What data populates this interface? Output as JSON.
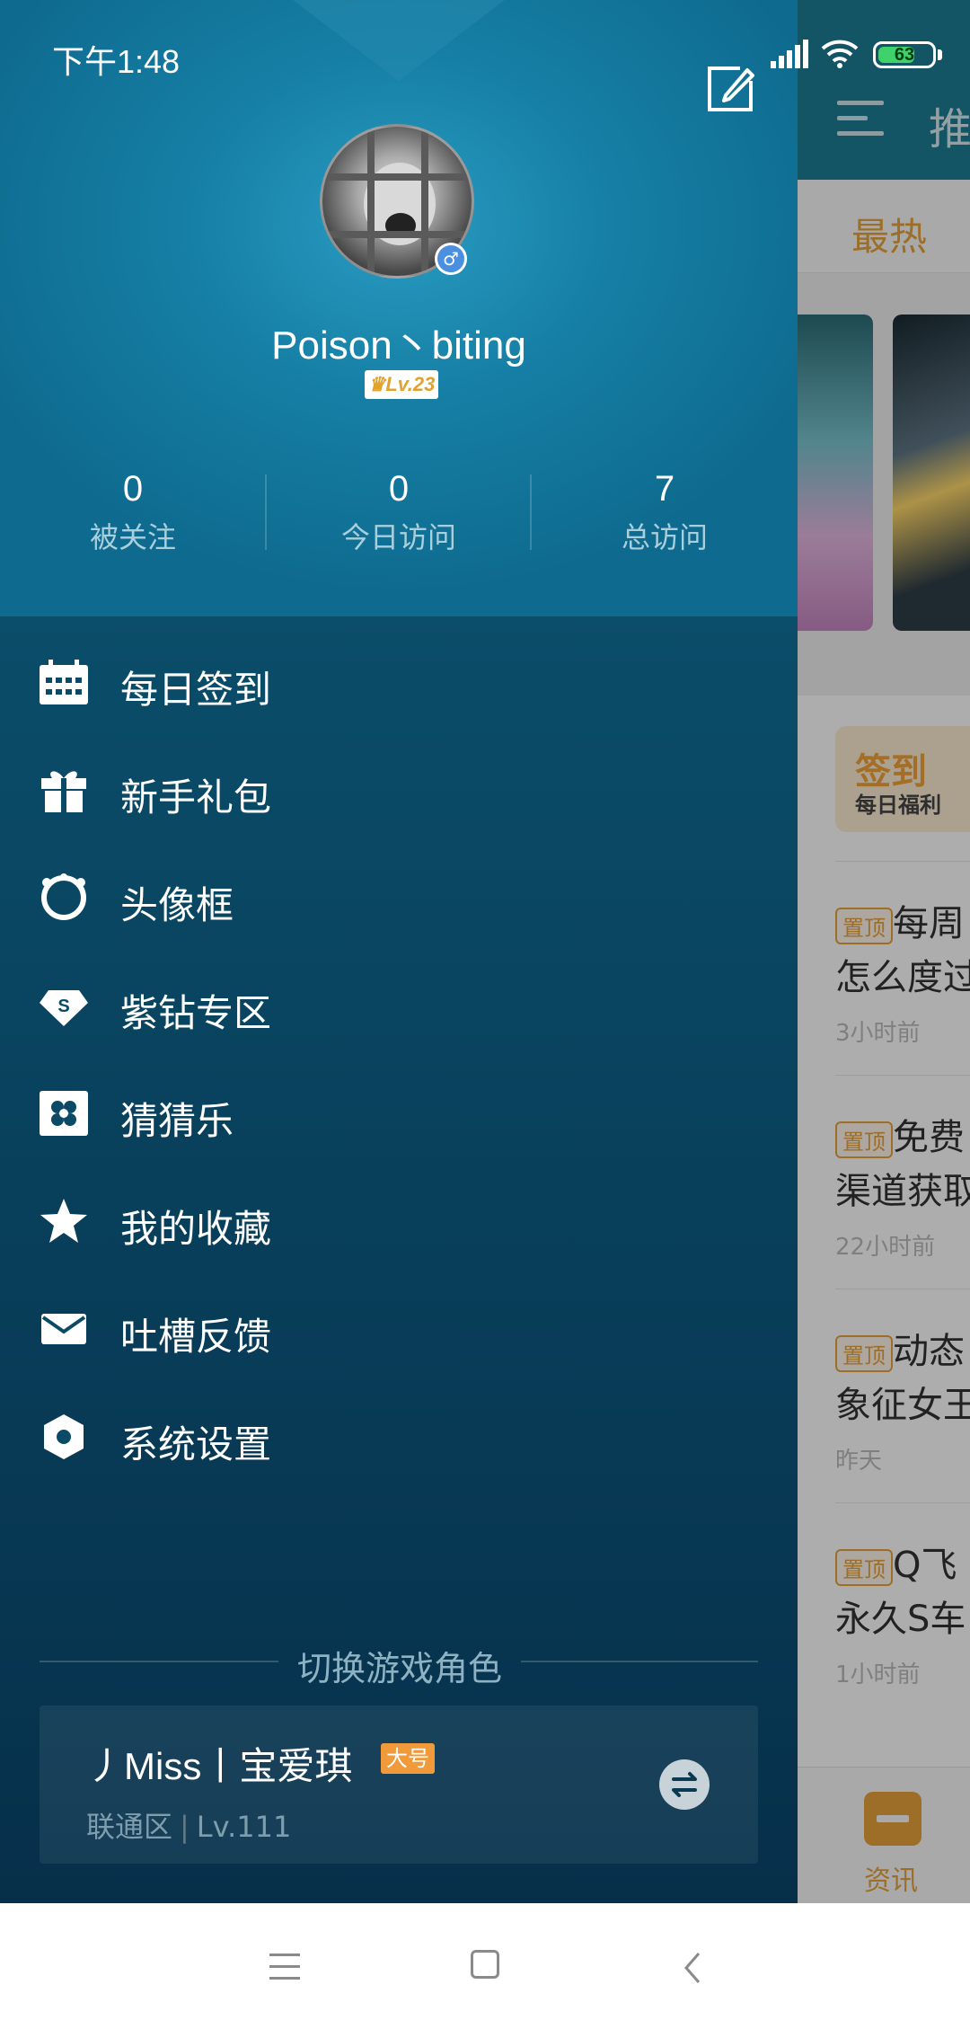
{
  "status_bar": {
    "time": "下午1:48",
    "battery": "63"
  },
  "background_page": {
    "title_partial": "推",
    "tab_hot": "最热",
    "checkin_title": "签到",
    "checkin_sub": "每日福利",
    "news": [
      {
        "tag": "置顶",
        "line1": "每周",
        "line2": "怎么度过",
        "time": "3小时前"
      },
      {
        "tag": "置顶",
        "line1": "免费",
        "line2": "渠道获取",
        "time": "22小时前"
      },
      {
        "tag": "置顶",
        "line1": "动态",
        "line2": "象征女王",
        "time": "昨天"
      },
      {
        "tag": "置顶",
        "line1": "Q飞",
        "line2": "永久S车",
        "time": "1小时前"
      }
    ],
    "bottom_nav_label": "资讯"
  },
  "profile": {
    "username": "Poison丶biting",
    "level": "Lv.23",
    "gender_symbol": "♂",
    "stats": [
      {
        "value": "0",
        "label": "被关注"
      },
      {
        "value": "0",
        "label": "今日访问"
      },
      {
        "value": "7",
        "label": "总访问"
      }
    ]
  },
  "menu": [
    {
      "label": "每日签到",
      "icon": "calendar-icon"
    },
    {
      "label": "新手礼包",
      "icon": "gift-icon"
    },
    {
      "label": "头像框",
      "icon": "avatar-frame-icon"
    },
    {
      "label": "紫钻专区",
      "icon": "diamond-icon"
    },
    {
      "label": "猜猜乐",
      "icon": "clover-icon"
    },
    {
      "label": "我的收藏",
      "icon": "star-icon"
    },
    {
      "label": "吐槽反馈",
      "icon": "mail-icon"
    },
    {
      "label": "系统设置",
      "icon": "settings-icon"
    }
  ],
  "switch_role": {
    "title": "切换游戏角色",
    "role_name": "丿Miss丨宝爱琪",
    "role_badge": "大号",
    "server": "联通区",
    "role_level": "Lv.111"
  },
  "colors": {
    "accent": "#e8a23b",
    "drawer_top": "#167fa5",
    "drawer_bottom": "#062f4a",
    "badge_orange": "#f09a3c"
  }
}
